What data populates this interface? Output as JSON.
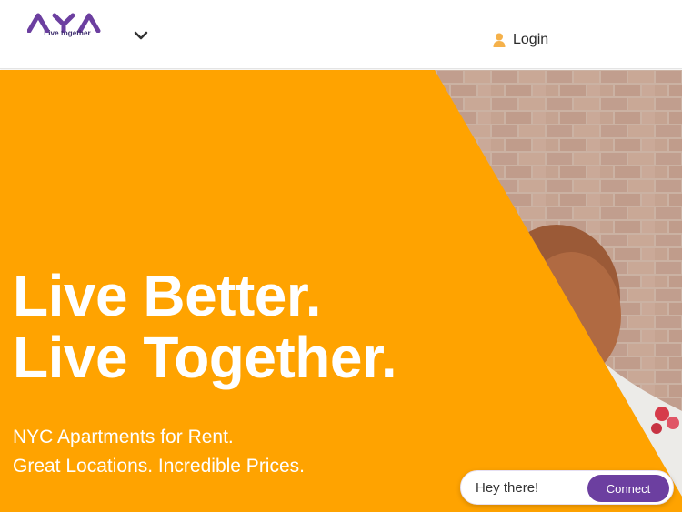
{
  "header": {
    "logo_text": "AYA",
    "logo_tagline": "Live together",
    "menu_icon": "chevron-down-icon",
    "login_label": "Login",
    "login_icon": "user-icon"
  },
  "hero": {
    "title_line1": "Live Better.",
    "title_line2": "Live Together.",
    "subtitle_line1": "NYC Apartments for Rent.",
    "subtitle_line2": "Great Locations. Incredible Prices."
  },
  "chat": {
    "greeting": "Hey there!",
    "button_label": "Connect"
  },
  "colors": {
    "brand_purple": "#6c3fa0",
    "hero_orange": "#ffa300",
    "icon_orange": "#f5b14a"
  }
}
